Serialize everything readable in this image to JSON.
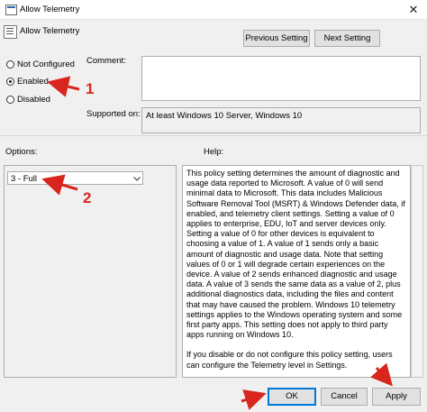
{
  "window": {
    "title": "Allow Telemetry",
    "close_glyph": "✕"
  },
  "header": {
    "title": "Allow Telemetry",
    "icon": "policy-icon"
  },
  "nav": {
    "previous_label": "Previous Setting",
    "next_label": "Next Setting"
  },
  "state": {
    "options": [
      {
        "label": "Not Configured",
        "selected": false
      },
      {
        "label": "Enabled",
        "selected": true
      },
      {
        "label": "Disabled",
        "selected": false
      }
    ]
  },
  "comment": {
    "label": "Comment:",
    "value": ""
  },
  "supported": {
    "label": "Supported on:",
    "value": "At least Windows 10 Server, Windows 10"
  },
  "options_label": "Options:",
  "help_label": "Help:",
  "telemetry_select": {
    "selected": "3 - Full"
  },
  "help_text": {
    "p1": "This policy setting determines the amount of diagnostic and usage data reported to Microsoft. A value of 0 will send minimal data to Microsoft. This data includes Malicious Software Removal Tool (MSRT) & Windows Defender data, if enabled, and telemetry client settings. Setting a value of 0 applies to enterprise, EDU, IoT and server devices only. Setting a value of 0 for other devices is equivalent to choosing a value of 1. A value of 1 sends only a basic amount of diagnostic and usage data. Note that setting values of 0 or 1 will degrade certain experiences on the device. A value of 2 sends enhanced diagnostic and usage data. A value of 3 sends the same data as a value of 2, plus additional diagnostics data, including the files and content that may have caused the problem. Windows 10 telemetry settings applies to the Windows operating system and some first party apps. This setting does not apply to third party apps running on Windows 10.",
    "p2": "If you disable or do not configure this policy setting, users can configure the Telemetry level in Settings."
  },
  "footer": {
    "ok_label": "OK",
    "cancel_label": "Cancel",
    "apply_label": "Apply"
  },
  "annotations": {
    "marker1": "1",
    "marker2": "2",
    "color": "#d8261e"
  }
}
